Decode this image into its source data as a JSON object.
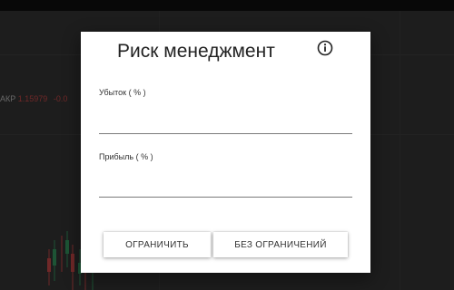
{
  "background": {
    "ticker_symbol": "АКР",
    "ticker_price": "1.15979",
    "ticker_change": "-0.0"
  },
  "dialog": {
    "title": "Риск менеджмент",
    "info_icon": "info-icon",
    "loss_label": "Убыток ( % )",
    "loss_value": "",
    "profit_label": "Прибыль ( % )",
    "profit_value": "",
    "limit_button": "ОГРАНИЧИТЬ",
    "no_limit_button": "БЕЗ ОГРАНИЧЕНИЙ"
  },
  "colors": {
    "overlay": "rgba(0,0,0,0.5)",
    "dialog_bg": "#ffffff",
    "loss_color": "#e05050",
    "up_candle": "#3aa86b"
  }
}
